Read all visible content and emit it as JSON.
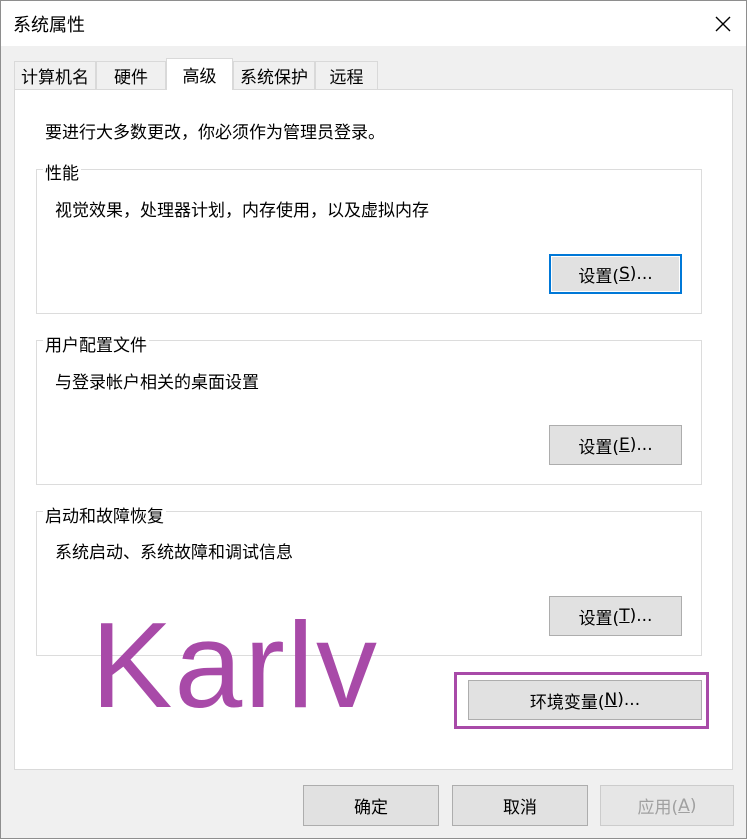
{
  "window": {
    "title": "系统属性"
  },
  "tabs": [
    {
      "label": "计算机名"
    },
    {
      "label": "硬件"
    },
    {
      "label": "高级"
    },
    {
      "label": "系统保护"
    },
    {
      "label": "远程"
    }
  ],
  "intro": "要进行大多数更改，你必须作为管理员登录。",
  "performance": {
    "title": "性能",
    "desc": "视觉效果，处理器计划，内存使用，以及虚拟内存",
    "btn_pre": "设置(",
    "btn_key": "S",
    "btn_post": ")..."
  },
  "profiles": {
    "title": "用户配置文件",
    "desc": "与登录帐户相关的桌面设置",
    "btn_pre": "设置(",
    "btn_key": "E",
    "btn_post": ")..."
  },
  "startup": {
    "title": "启动和故障恢复",
    "desc": "系统启动、系统故障和调试信息",
    "btn_pre": "设置(",
    "btn_key": "T",
    "btn_post": ")..."
  },
  "env": {
    "pre": "环境变量(",
    "key": "N",
    "post": ")..."
  },
  "footer": {
    "ok": "确定",
    "cancel": "取消",
    "apply_pre": "应用(",
    "apply_key": "A",
    "apply_post": ")"
  },
  "watermark": "Karlv",
  "colors": {
    "accent": "#0078d7",
    "highlight": "#a84aa8"
  }
}
